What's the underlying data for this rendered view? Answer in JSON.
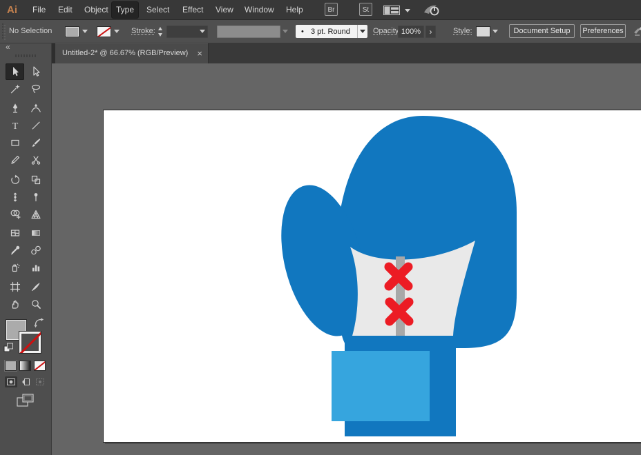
{
  "menubar": {
    "logo": "Ai",
    "items": [
      "File",
      "Edit",
      "Object",
      "Type",
      "Select",
      "Effect",
      "View",
      "Window",
      "Help"
    ],
    "active_item": "Type",
    "bridge_button": "Br",
    "stock_button": "St"
  },
  "optionsbar": {
    "selection_status": "No Selection",
    "stroke_label": "Stroke:",
    "brush_preview_glyph": "•",
    "brush_value": "3 pt. Round",
    "opacity_label": "Opacity:",
    "opacity_value": "100%",
    "opacity_more_glyph": "›",
    "style_label": "Style:",
    "document_setup_button": "Document Setup",
    "preferences_button": "Preferences"
  },
  "tabbar": {
    "collapse_glyph": "«",
    "document_title": "Untitled-2* @ 66.67% (RGB/Preview)",
    "close_glyph": "×"
  },
  "tools": [
    "Selection",
    "Direct Selection",
    "Magic Wand",
    "Lasso",
    "Pen",
    "Curvature",
    "Type",
    "Line Segment",
    "Rectangle",
    "Paintbrush",
    "Shaper",
    "Scissors",
    "Rotate",
    "Scale",
    "Width",
    "Puppet Warp",
    "Shape Builder",
    "Perspective Grid",
    "Mesh",
    "Gradient",
    "Eyedropper",
    "Blend",
    "Symbol Sprayer",
    "Column Graph",
    "Artboard",
    "Slice",
    "Hand",
    "Zoom"
  ],
  "artwork": {
    "subject": "Blue boxing glove illustration on white artboard",
    "colors": {
      "glove_blue": "#1177BF",
      "wristband_blue": "#36A5DE",
      "lace_panel_gray": "#E9E9E9",
      "strap_gray": "#A8A8A8",
      "cross_red": "#EC1C24"
    }
  },
  "ui_colors": {
    "menubar_bg": "#383838",
    "optionsbar_bg": "#4F4F4F",
    "panel_bg": "#4E4E4E",
    "pasteboard_gray": "#656565",
    "logo_orange": "#C2804E",
    "selected_tool_bg": "#272727"
  }
}
